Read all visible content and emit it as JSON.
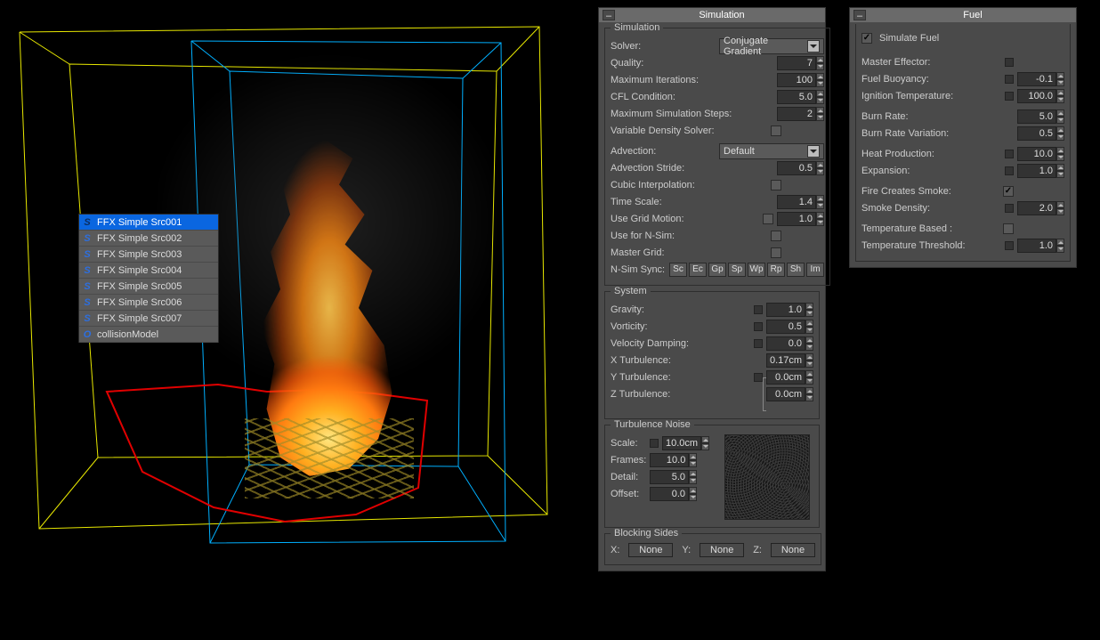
{
  "scene_list": {
    "items": [
      {
        "icon": "S",
        "label": "FFX Simple Src001",
        "selected": true
      },
      {
        "icon": "S",
        "label": "FFX Simple Src002"
      },
      {
        "icon": "S",
        "label": "FFX Simple Src003"
      },
      {
        "icon": "S",
        "label": "FFX Simple Src004"
      },
      {
        "icon": "S",
        "label": "FFX Simple Src005"
      },
      {
        "icon": "S",
        "label": "FFX Simple Src006"
      },
      {
        "icon": "S",
        "label": "FFX Simple Src007"
      },
      {
        "icon": "O",
        "label": "collisionModel"
      }
    ]
  },
  "panel_sim": {
    "title": "Simulation",
    "groups": {
      "simulation": {
        "legend": "Simulation",
        "solver_label": "Solver:",
        "solver_value": "Conjugate Gradient",
        "quality_label": "Quality:",
        "quality_value": "7",
        "maxiter_label": "Maximum Iterations:",
        "maxiter_value": "100",
        "cfl_label": "CFL Condition:",
        "cfl_value": "5.0",
        "maxsteps_label": "Maximum Simulation Steps:",
        "maxsteps_value": "2",
        "vardens_label": "Variable Density Solver:",
        "advection_label": "Advection:",
        "advection_value": "Default",
        "advstride_label": "Advection Stride:",
        "advstride_value": "0.5",
        "cubic_label": "Cubic Interpolation:",
        "timescale_label": "Time Scale:",
        "timescale_value": "1.4",
        "gridmotion_label": "Use Grid Motion:",
        "gridmotion_value": "1.0",
        "nsim_label": "Use for N-Sim:",
        "mastergrid_label": "Master Grid:",
        "nsimsync_label": "N-Sim Sync:",
        "nsim_buttons": [
          "Sc",
          "Ec",
          "Gp",
          "Sp",
          "Wp",
          "Rp",
          "Sh",
          "Im"
        ]
      },
      "system": {
        "legend": "System",
        "gravity_label": "Gravity:",
        "gravity_value": "1.0",
        "vorticity_label": "Vorticity:",
        "vorticity_value": "0.5",
        "veldamp_label": "Velocity Damping:",
        "veldamp_value": "0.0",
        "xturb_label": "X Turbulence:",
        "xturb_value": "0.17cm",
        "yturb_label": "Y Turbulence:",
        "yturb_value": "0.0cm",
        "zturb_label": "Z Turbulence:",
        "zturb_value": "0.0cm"
      },
      "turbnoise": {
        "legend": "Turbulence Noise",
        "scale_label": "Scale:",
        "scale_value": "10.0cm",
        "frames_label": "Frames:",
        "frames_value": "10.0",
        "detail_label": "Detail:",
        "detail_value": "5.0",
        "offset_label": "Offset:",
        "offset_value": "0.0"
      },
      "blocking": {
        "legend": "Blocking Sides",
        "x_label": "X:",
        "x_value": "None",
        "y_label": "Y:",
        "y_value": "None",
        "z_label": "Z:",
        "z_value": "None"
      }
    }
  },
  "panel_fuel": {
    "title": "Fuel",
    "simulate_fuel_label": "Simulate Fuel",
    "simulate_fuel_checked": true,
    "master_eff_label": "Master Effector:",
    "buoyancy_label": "Fuel Buoyancy:",
    "buoyancy_value": "-0.1",
    "ignition_label": "Ignition Temperature:",
    "ignition_value": "100.0",
    "burnrate_label": "Burn Rate:",
    "burnrate_value": "5.0",
    "burnvar_label": "Burn Rate Variation:",
    "burnvar_value": "0.5",
    "heatprod_label": "Heat Production:",
    "heatprod_value": "10.0",
    "expansion_label": "Expansion:",
    "expansion_value": "1.0",
    "firecreates_label": "Fire Creates Smoke:",
    "firecreates_checked": true,
    "smokedens_label": "Smoke Density:",
    "smokedens_value": "2.0",
    "tempbased_label": "Temperature Based :",
    "tempthresh_label": "Temperature Threshold:",
    "tempthresh_value": "1.0"
  }
}
